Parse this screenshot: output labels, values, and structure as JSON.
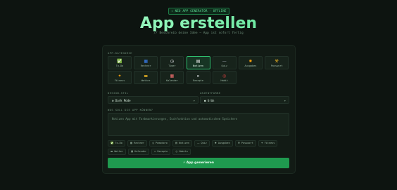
{
  "header": {
    "badge": "✦ NEO APP GENERATOR · OFFLINE",
    "title": "App erstellen",
    "subtitle": "// Beschreib deine Idee — App ist sofort fertig"
  },
  "categories": {
    "label": "APP-KATEGORIE",
    "items": [
      {
        "icon": "✅",
        "label": "To-Do",
        "icon_name": "checkmark-icon",
        "color": "#2fbf4f"
      },
      {
        "icon": "▦",
        "label": "Rechner",
        "icon_name": "calculator-icon",
        "color": "#3b82f6"
      },
      {
        "icon": "◷",
        "label": "Timer",
        "icon_name": "clock-icon",
        "color": "#e5e7eb"
      },
      {
        "icon": "▤",
        "label": "Notizen",
        "icon_name": "notes-icon",
        "color": "#f5f5f5",
        "selected": true
      },
      {
        "icon": "—",
        "label": "Quiz",
        "icon_name": "dash-icon",
        "color": "#9ca3af"
      },
      {
        "icon": "✸",
        "label": "Ausgaben",
        "icon_name": "money-bag-icon",
        "color": "#f59e0b"
      },
      {
        "icon": "⚒",
        "label": "Passwort",
        "icon_name": "key-icon",
        "color": "#fbbf24"
      },
      {
        "icon": "✦",
        "label": "Fitness",
        "icon_name": "flexed-arm-icon",
        "color": "#f59e0b"
      },
      {
        "icon": "▬",
        "label": "Wetter",
        "icon_name": "cloud-sun-icon",
        "color": "#fbbf24"
      },
      {
        "icon": "▦",
        "label": "Kalender",
        "icon_name": "calendar-icon",
        "color": "#f87171"
      },
      {
        "icon": "▫",
        "label": "Rezepte",
        "icon_name": "recipe-icon",
        "color": "#e5e7eb"
      },
      {
        "icon": "◎",
        "label": "Habit",
        "icon_name": "target-icon",
        "color": "#ef4444"
      }
    ]
  },
  "design": {
    "label": "DESIGN-STIL",
    "value": "⚙ Dark Mode"
  },
  "accent": {
    "label": "AKZENTFARBE",
    "value": "● Grün",
    "color": "#22c55e"
  },
  "description": {
    "label": "WAS SOLL DIE APP KÖNNEN?",
    "placeholder": "Notizen App mit Farbmarkierungen, Suchfunktion und automatischem Speichern"
  },
  "chips": [
    {
      "icon": "✅",
      "label": "To-Do",
      "icon_name": "checkmark-icon"
    },
    {
      "icon": "▦",
      "label": "Rechner",
      "icon_name": "calculator-icon"
    },
    {
      "icon": "◷",
      "label": "Pomodoro",
      "icon_name": "clock-icon"
    },
    {
      "icon": "▤",
      "label": "Notizen",
      "icon_name": "notes-icon"
    },
    {
      "icon": "—",
      "label": "Quiz",
      "icon_name": "dash-icon"
    },
    {
      "icon": "✸",
      "label": "Ausgaben",
      "icon_name": "money-bag-icon"
    },
    {
      "icon": "⚒",
      "label": "Passwort",
      "icon_name": "key-icon"
    },
    {
      "icon": "✦",
      "label": "Fitness",
      "icon_name": "flexed-arm-icon"
    },
    {
      "icon": "▬",
      "label": "Wetter",
      "icon_name": "cloud-sun-icon"
    },
    {
      "icon": "▦",
      "label": "Kalender",
      "icon_name": "calendar-icon"
    },
    {
      "icon": "▫",
      "label": "Rezepte",
      "icon_name": "recipe-icon"
    },
    {
      "icon": "◎",
      "label": "Habits",
      "icon_name": "target-icon"
    }
  ],
  "submit": {
    "label": "⚡ App generieren"
  }
}
